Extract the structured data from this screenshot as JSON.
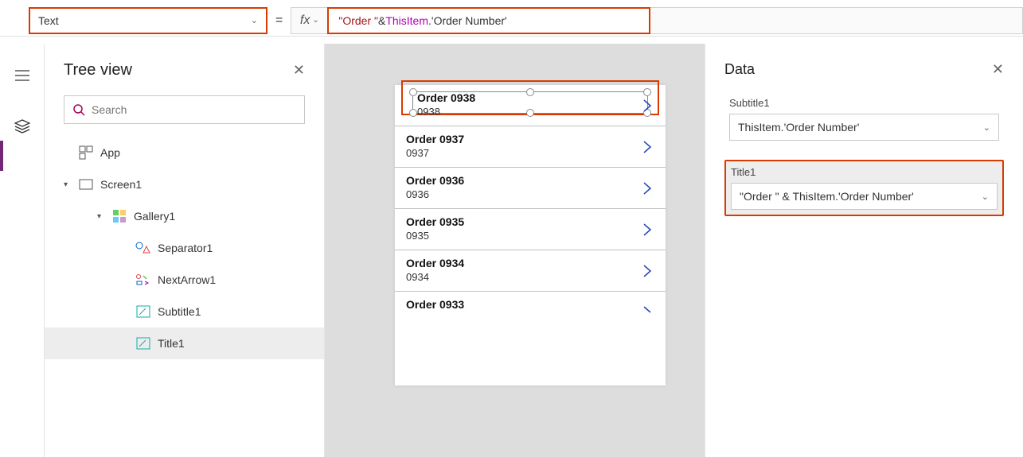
{
  "formula": {
    "property": "Text",
    "equals": "=",
    "fx": "fx",
    "tokens": {
      "str": "\"Order \"",
      "op1": " & ",
      "ident": "ThisItem",
      "dot": ".",
      "field": "'Order Number'"
    }
  },
  "tree": {
    "title": "Tree view",
    "search_placeholder": "Search",
    "items": {
      "app": "App",
      "screen": "Screen1",
      "gallery": "Gallery1",
      "separator": "Separator1",
      "nextarrow": "NextArrow1",
      "subtitle": "Subtitle1",
      "title": "Title1"
    }
  },
  "gallery": [
    {
      "title": "Order 0938",
      "subtitle": "0938",
      "selected": true
    },
    {
      "title": "Order 0937",
      "subtitle": "0937"
    },
    {
      "title": "Order 0936",
      "subtitle": "0936"
    },
    {
      "title": "Order 0935",
      "subtitle": "0935"
    },
    {
      "title": "Order 0934",
      "subtitle": "0934"
    },
    {
      "title": "Order 0933",
      "subtitle": "",
      "last": true
    }
  ],
  "dataPanel": {
    "title": "Data",
    "subtitle_label": "Subtitle1",
    "subtitle_value": "ThisItem.'Order Number'",
    "title_label": "Title1",
    "title_value": "\"Order \" & ThisItem.'Order Number'"
  }
}
